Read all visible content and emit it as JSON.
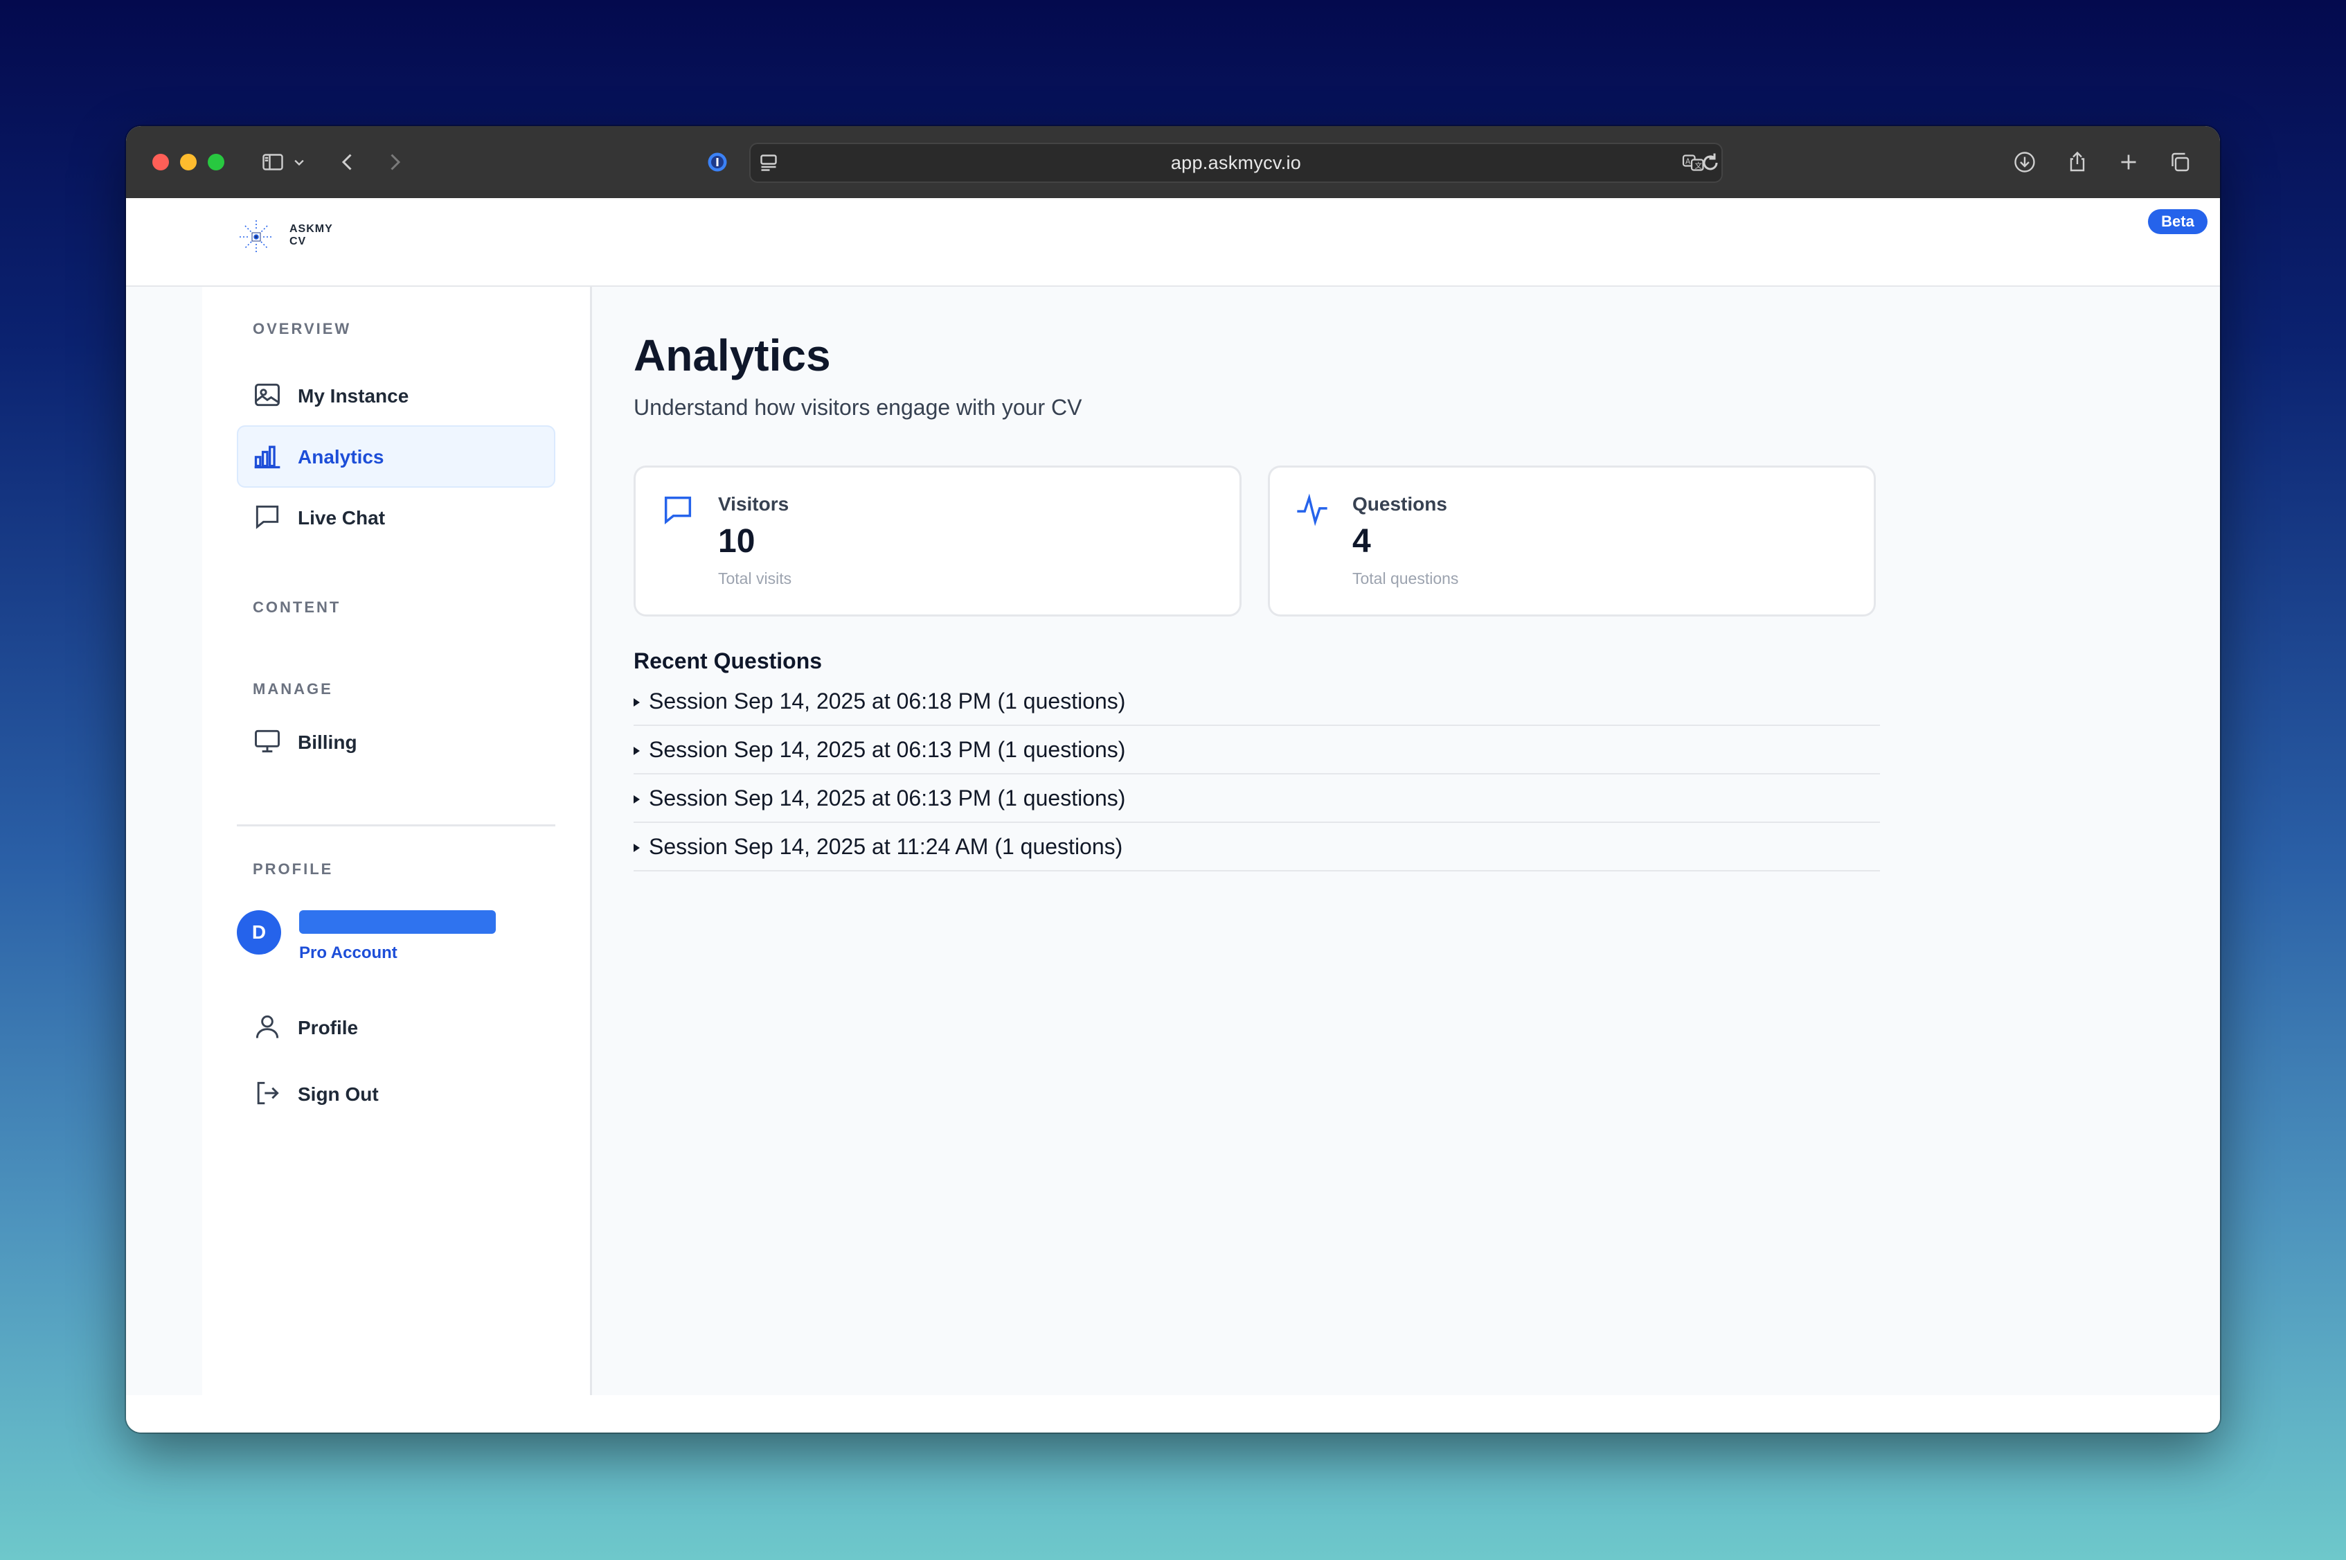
{
  "browser": {
    "url": "app.askmycv.io"
  },
  "header": {
    "logo_line1": "ASKMY",
    "logo_line2": "CV",
    "badge": "Beta"
  },
  "sidebar": {
    "sections": {
      "overview": "OVERVIEW",
      "content": "CONTENT",
      "manage": "MANAGE",
      "profile": "PROFILE"
    },
    "items": {
      "my_instance": "My Instance",
      "analytics": "Analytics",
      "live_chat": "Live Chat",
      "billing": "Billing",
      "profile": "Profile",
      "sign_out": "Sign Out"
    },
    "active": "analytics",
    "user": {
      "avatar_initial": "D",
      "account_type": "Pro Account"
    }
  },
  "main": {
    "title": "Analytics",
    "subtitle": "Understand how visitors engage with your CV",
    "cards": {
      "visitors": {
        "label": "Visitors",
        "value": "10",
        "sub": "Total visits"
      },
      "questions": {
        "label": "Questions",
        "value": "4",
        "sub": "Total questions"
      }
    },
    "recent_title": "Recent Questions",
    "sessions": [
      "Session Sep 14, 2025 at 06:18 PM (1 questions)",
      "Session Sep 14, 2025 at 06:13 PM (1 questions)",
      "Session Sep 14, 2025 at 06:13 PM (1 questions)",
      "Session Sep 14, 2025 at 11:24 AM (1 questions)"
    ]
  },
  "colors": {
    "accent": "#2563eb",
    "active_bg": "#eff6ff",
    "toolbar": "#353535"
  }
}
